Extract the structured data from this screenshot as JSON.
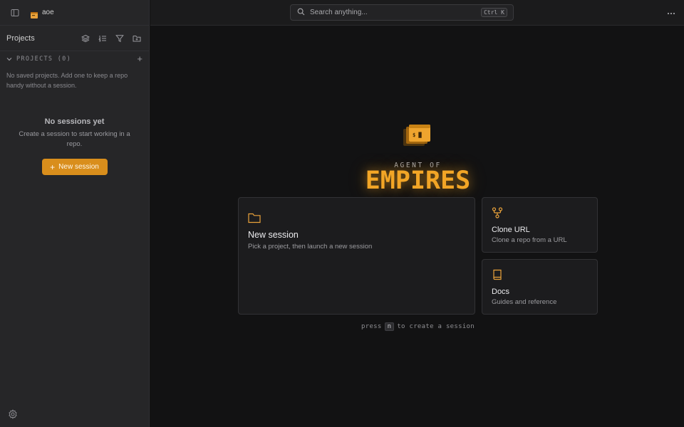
{
  "app": {
    "name": "aoe"
  },
  "sidebar": {
    "projects_title": "Projects",
    "projects_header": "PROJECTS (0)",
    "empty_projects_text": "No saved projects. Add one to keep a repo handy without a session.",
    "no_sessions_title": "No sessions yet",
    "no_sessions_desc": "Create a session to start working in a repo.",
    "new_session_button": "New session",
    "icons": [
      "sidebar-toggle-icon",
      "layers-icon",
      "list-ordered-icon",
      "filter-icon",
      "folder-plus-icon",
      "chevron-down-icon",
      "plus-icon",
      "gear-icon"
    ]
  },
  "topbar": {
    "search_placeholder": "Search anything...",
    "search_shortcut": "Ctrl K",
    "more_icon": "more-horizontal-icon"
  },
  "hero": {
    "logo_text": "$ █",
    "tagline": "AGENT OF",
    "title": "EMPIRES"
  },
  "cards": {
    "new_session": {
      "title": "New session",
      "subtitle": "Pick a project, then launch a new session",
      "icon": "folder-icon"
    },
    "clone_url": {
      "title": "Clone URL",
      "subtitle": "Clone a repo from a URL",
      "icon": "git-fork-icon"
    },
    "docs": {
      "title": "Docs",
      "subtitle": "Guides and reference",
      "icon": "book-icon"
    }
  },
  "hint": {
    "before": "press",
    "key": "n",
    "after": "to create a session"
  },
  "colors": {
    "accent": "#d98e1c",
    "brand": "#f2a526",
    "background": "#121213",
    "sidebar": "#262628"
  }
}
